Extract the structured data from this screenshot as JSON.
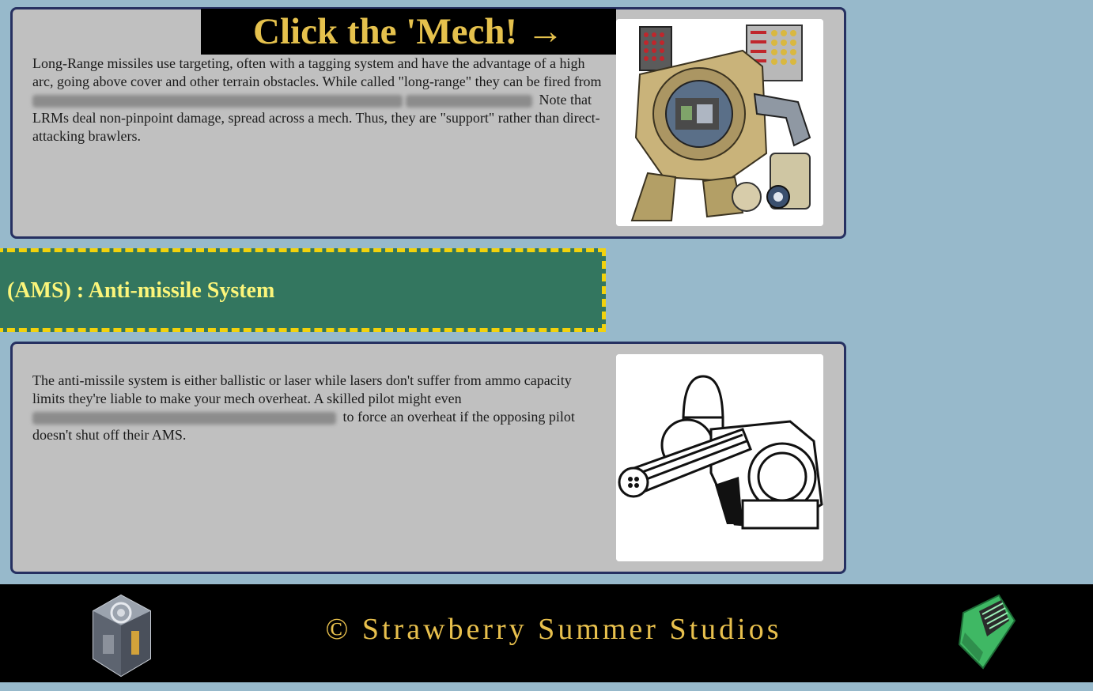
{
  "banner": {
    "click_label": "Click the 'Mech! →"
  },
  "lrm_card": {
    "text_part1": "Long-Range missiles use targeting, often with a tagging system and have the advantage of a high arc, going above cover and other terrain obstacles. While called \"long-range\" they can be fired from",
    "text_part2": "Note that LRMs deal non-pinpoint damage, spread across a mech. Thus, they are \"support\" rather than direct-attacking brawlers.",
    "image_icon": "mech-cutaway-icon"
  },
  "ams_section": {
    "title": "(AMS) : Anti-missile System"
  },
  "ams_card": {
    "text_part1": "The anti-missile system is either ballistic or laser while lasers don't suffer from ammo capacity limits they're liable to make your mech overheat. A skilled pilot might even",
    "text_part2": "to force an overheat if the opposing pilot doesn't shut off their AMS.",
    "image_icon": "gatling-turret-icon"
  },
  "footer": {
    "copyright": "© Strawberry Summer Studios",
    "left_icon": "mech-cube-icon",
    "right_icon": "circuit-board-icon"
  },
  "colors": {
    "page_background": "#97b9cb",
    "card_background": "#c0c0c0",
    "card_border": "#263061",
    "banner_text": "#e5c14d",
    "section_background": "#33765f",
    "section_border": "#f2d20c",
    "section_text": "#fbf57a",
    "footer_background": "#000000",
    "footer_text": "#e8c04d"
  }
}
